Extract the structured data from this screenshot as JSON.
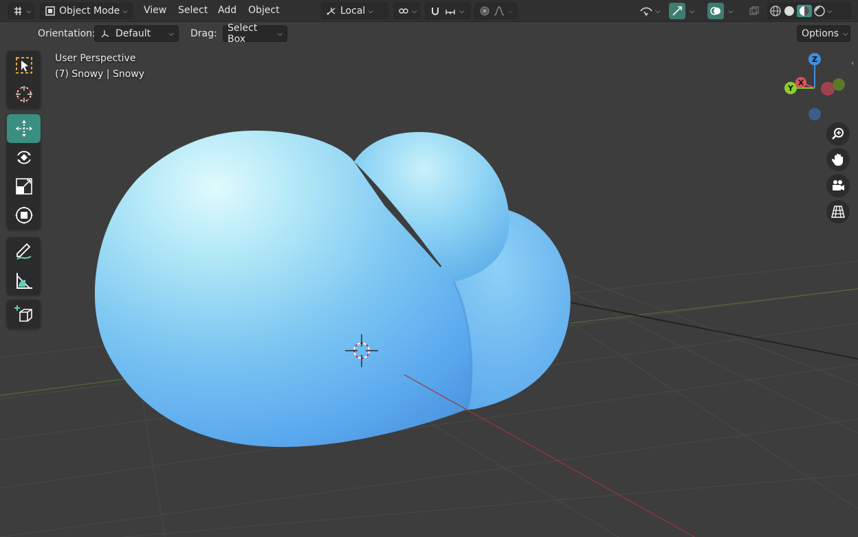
{
  "header": {
    "editor_type_icon": "editor-type-3d-viewport-icon",
    "mode_label": "Object Mode",
    "menus": [
      "View",
      "Select",
      "Add",
      "Object"
    ],
    "transform_pivot_label": "Local",
    "snap_icon": "magnet-icon",
    "proportional_icon": "proportional-edit-icon"
  },
  "tool_settings": {
    "orientation_label": "Orientation:",
    "orientation_value": "Default",
    "drag_label": "Drag:",
    "drag_value": "Select Box",
    "options_label": "Options"
  },
  "viewport": {
    "view_name": "User Perspective",
    "collection_object": "(7) Snowy | Snowy"
  },
  "gizmo": {
    "axes": [
      "Z",
      "X",
      "Y"
    ],
    "colors": {
      "x": "#e0505f",
      "y": "#8ccf2c",
      "z": "#3f8fe0"
    }
  },
  "toolbox": {
    "tools": [
      "select-box",
      "cursor",
      "move",
      "rotate",
      "scale",
      "transform",
      "annotate",
      "measure",
      "add-cube"
    ]
  },
  "navigation": [
    "zoom",
    "pan",
    "camera",
    "perspective-toggle"
  ],
  "colors": {
    "accent": "#3b8f80",
    "object_color": "#6fb8f0",
    "background": "#3d3d3d"
  }
}
